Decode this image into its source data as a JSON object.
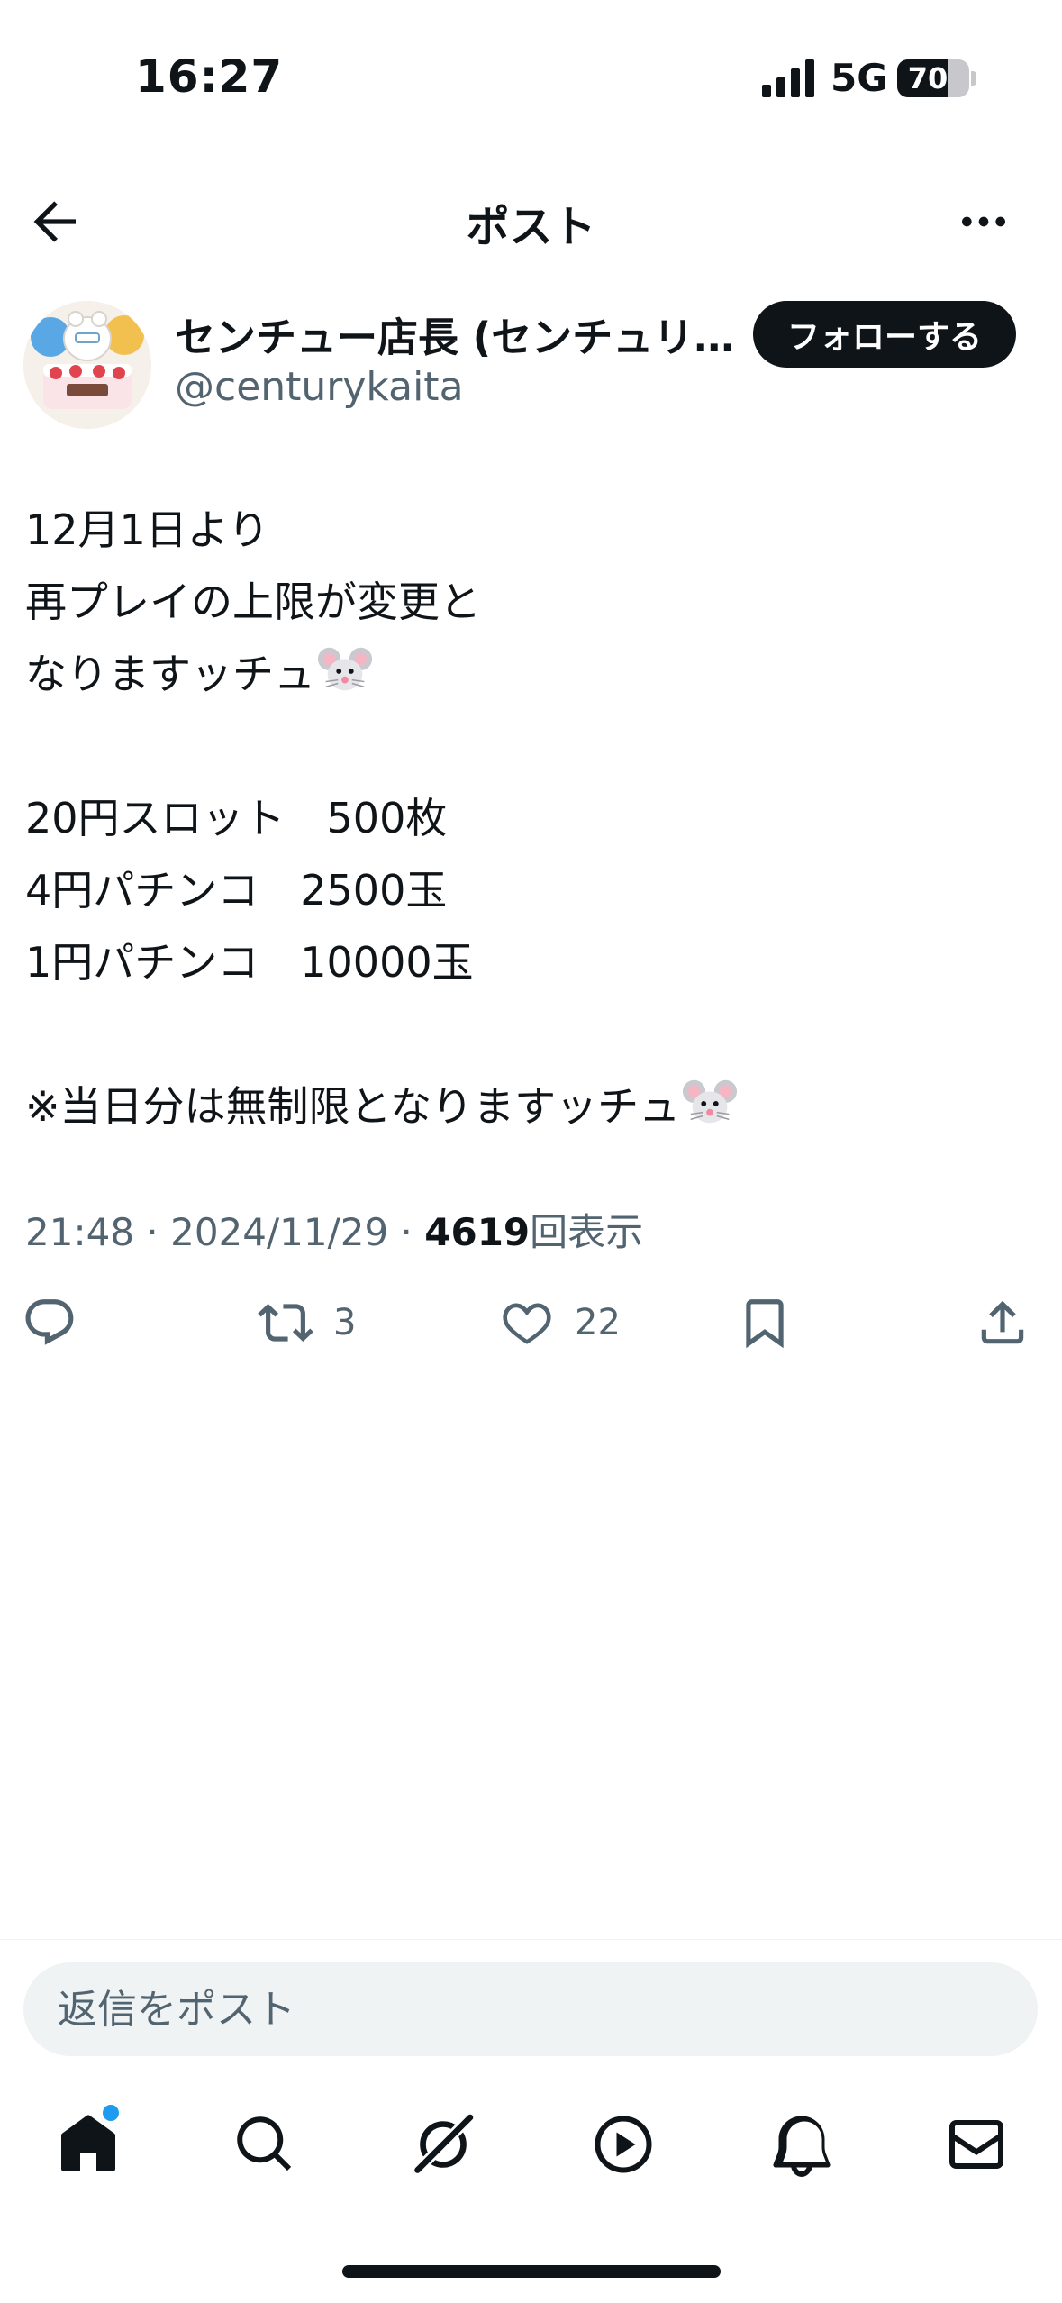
{
  "status_bar": {
    "time": "16:27",
    "network": "5G",
    "battery": "70",
    "battery_level": 0.7
  },
  "nav": {
    "title": "ポスト",
    "back_icon": "arrow-left-icon",
    "more_icon": "more-horizontal-icon"
  },
  "author": {
    "display_name": "センチュー店長 (センチュリ…",
    "handle": "@centurykaita",
    "follow_label": "フォローする"
  },
  "tweet": {
    "lines": [
      "12月1日より",
      "再プレイの上限が変更と",
      "なりますッチュ",
      "",
      "20円スロット　500枚",
      "4円パチンコ　2500玉",
      "1円パチンコ　10000玉",
      "",
      "※当日分は無制限となりますッチュ"
    ],
    "emoji_icon": "mouse-face-icon"
  },
  "meta": {
    "time": "21:48",
    "separator": " · ",
    "date": "2024/11/29",
    "views_count": "4619",
    "views_label": "回表示"
  },
  "actions": {
    "reply_count": "",
    "retweet_count": "3",
    "like_count": "22"
  },
  "reply": {
    "placeholder": "返信をポスト"
  },
  "tabbar": {
    "items": [
      "home-icon",
      "search-icon",
      "grok-icon",
      "video-icon",
      "notifications-icon",
      "messages-icon"
    ]
  },
  "colors": {
    "text": "#0f1419",
    "secondary": "#536471",
    "accent": "#1d9bf0",
    "surface": "#eff3f4"
  }
}
